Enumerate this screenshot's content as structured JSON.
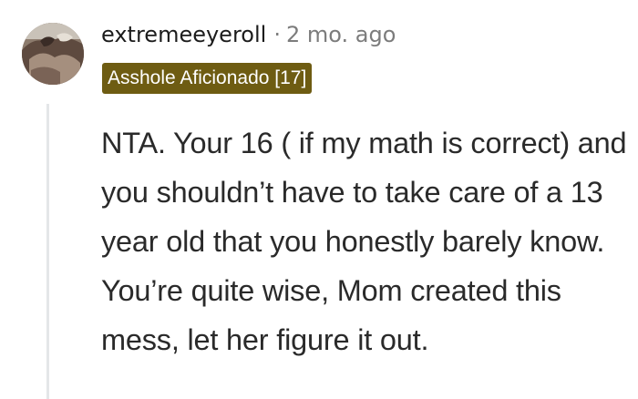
{
  "comment": {
    "username": "extremeeyeroll",
    "separator": "·",
    "timestamp": "2 mo. ago",
    "flair": "Asshole Aficionado [17]",
    "body": "NTA. Your 16 ( if my math is correct) and you shouldn’t have to take care of a 13 year old that you honestly barely know. You’re quite wise, Mom created this mess, let her figure it out."
  },
  "colors": {
    "flair_background": "#6e5c12",
    "flair_text": "#ffffff",
    "meta_text": "#7c7c7c",
    "thread_line": "#e4e6e8"
  },
  "icons": {
    "avatar": "user-avatar-photo"
  }
}
